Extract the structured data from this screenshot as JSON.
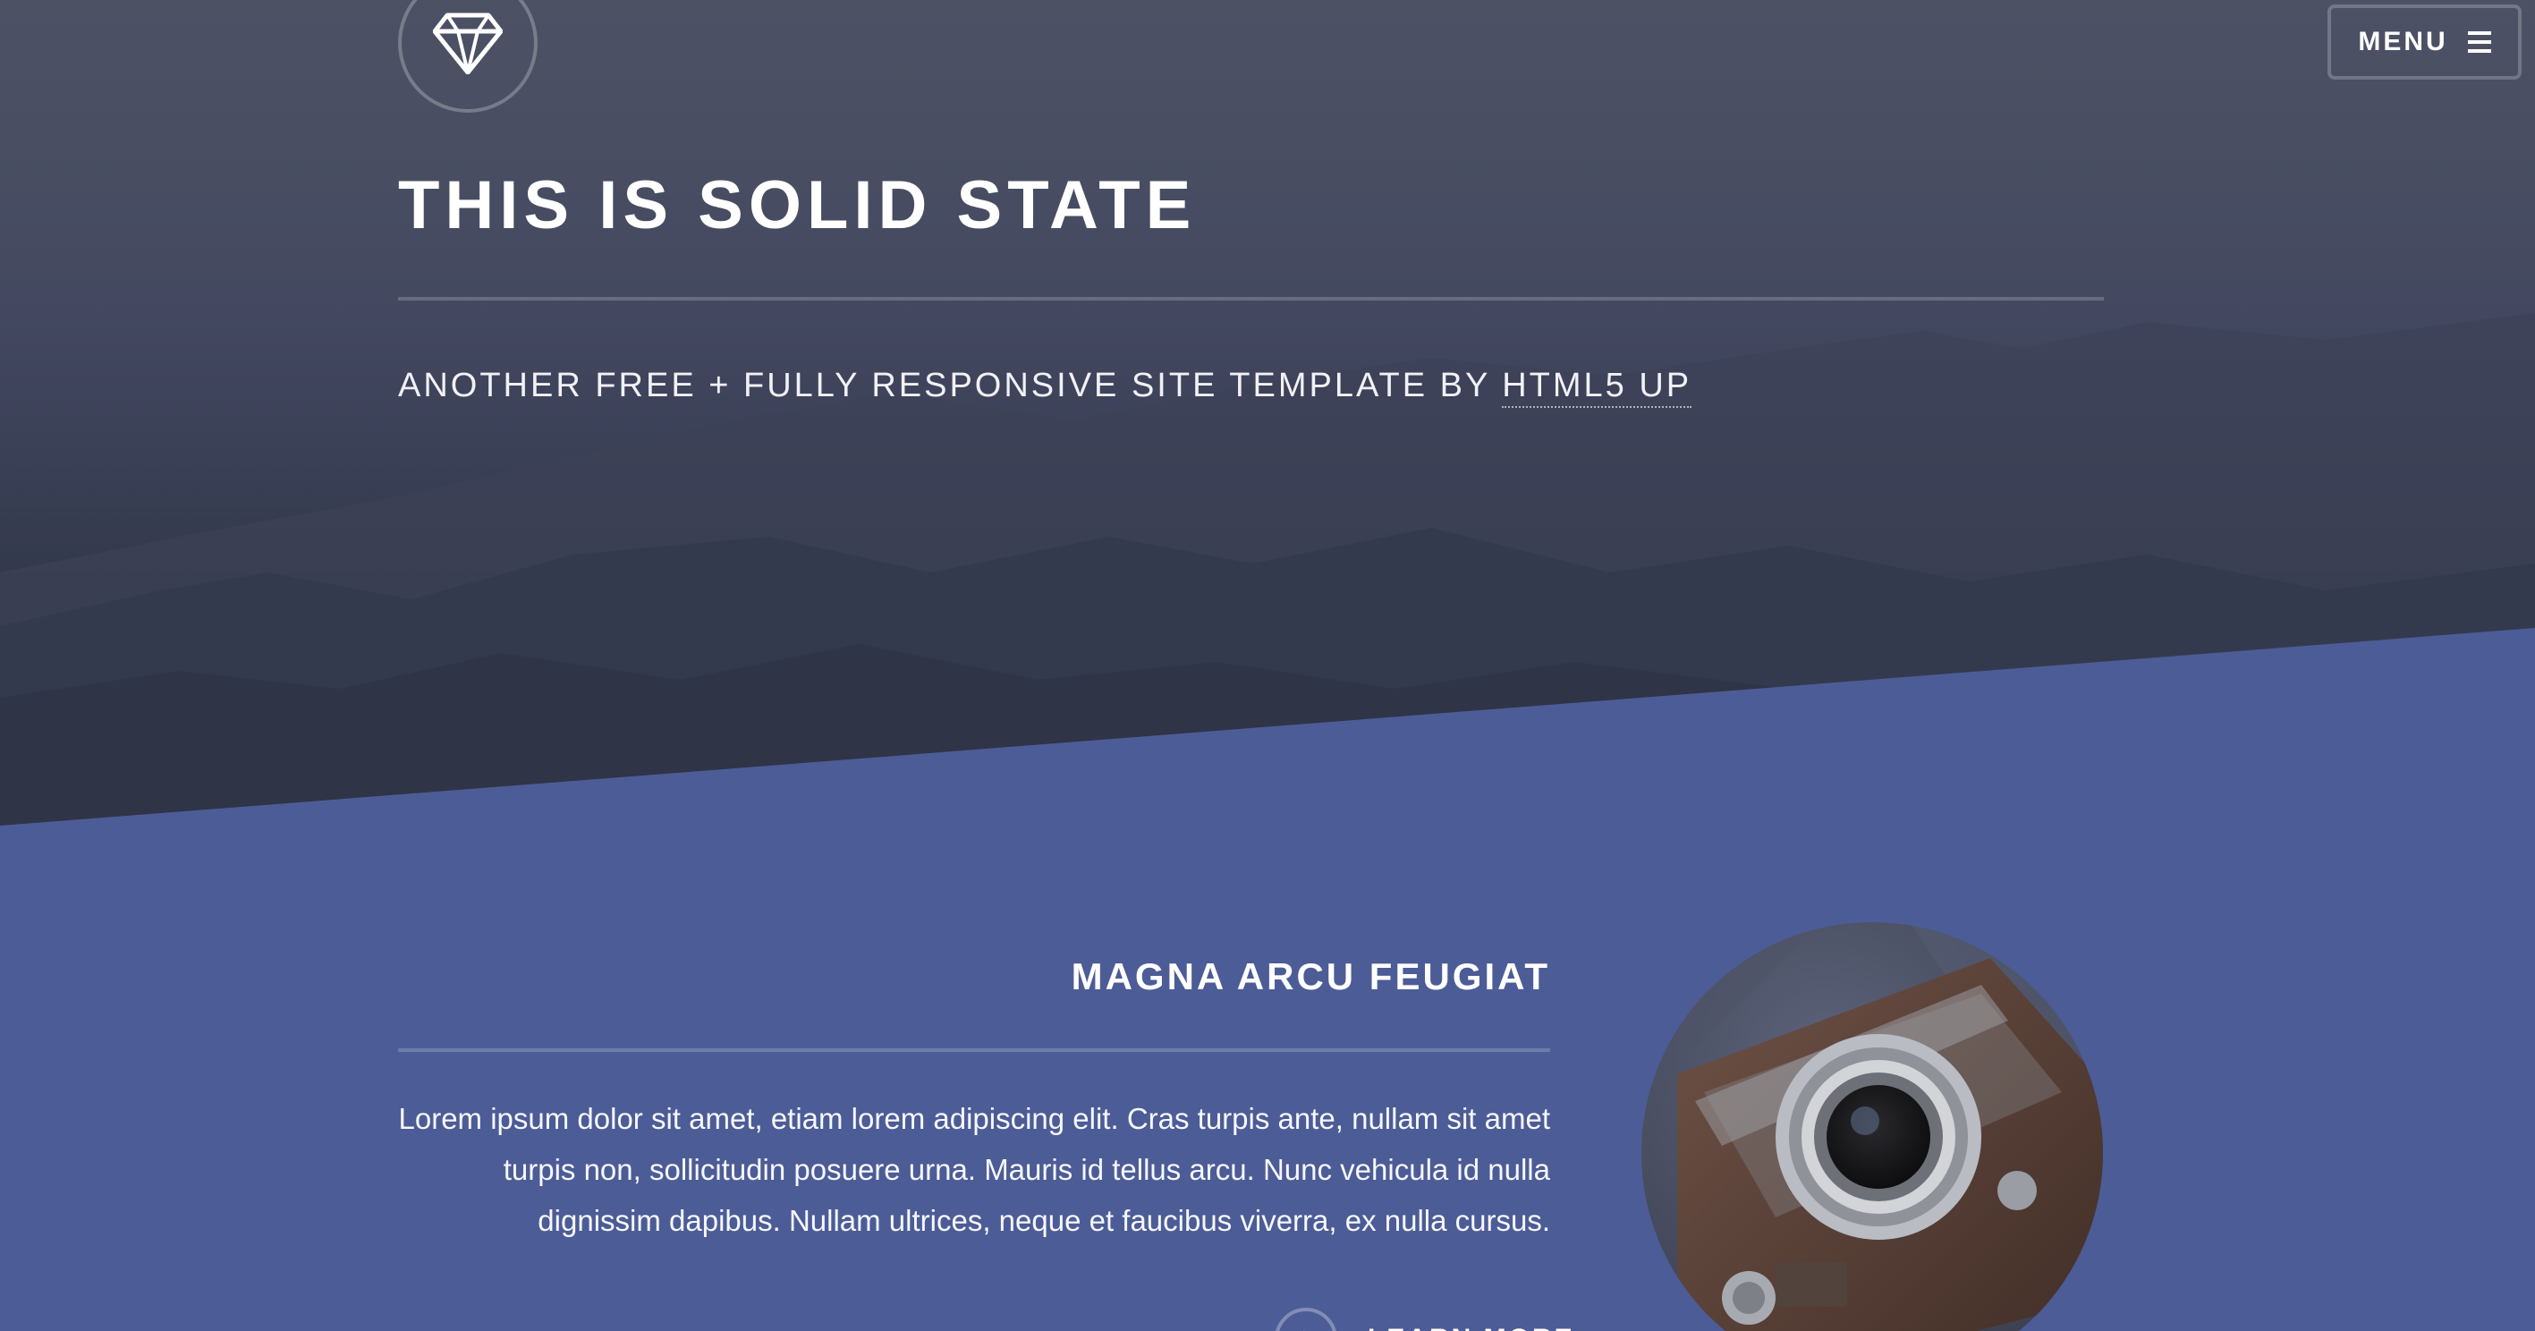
{
  "header": {
    "logo_icon": "diamond-icon",
    "menu_label": "MENU",
    "menu_icon": "hamburger-icon"
  },
  "hero": {
    "title": "THIS IS SOLID STATE",
    "subtitle_prefix": "ANOTHER FREE + FULLY RESPONSIVE SITE TEMPLATE BY ",
    "subtitle_link": "HTML5 UP"
  },
  "feature": {
    "title": "MAGNA ARCU FEUGIAT",
    "body": "Lorem ipsum dolor sit amet, etiam lorem adipiscing elit. Cras turpis ante, nullam sit amet turpis non, sollicitudin posuere urna. Mauris id tellus arcu. Nunc vehicula id nulla dignissim dapibus. Nullam ultrices, neque et faucibus viverra, ex nulla cursus.",
    "link_label": "LEARN MORE",
    "link_icon": "arrow-right-icon",
    "image_subject": "camera-photo"
  },
  "colors": {
    "hero_bg": "#434860",
    "section_bg": "#4c5c96",
    "text": "#ffffff"
  }
}
